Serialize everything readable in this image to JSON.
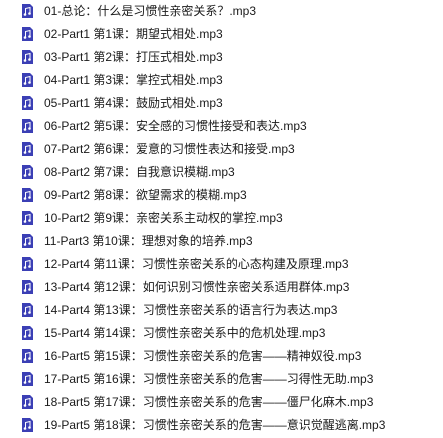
{
  "file_list": {
    "icon": "audio-file-icon",
    "icon_color": "#3b3fb5",
    "items": [
      {
        "name": "01-总论：什么是习惯性亲密关系？.mp3"
      },
      {
        "name": "02-Part1 第1课：期望式相处.mp3"
      },
      {
        "name": "03-Part1 第2课：打压式相处.mp3"
      },
      {
        "name": "04-Part1 第3课：掌控式相处.mp3"
      },
      {
        "name": "05-Part1 第4课：鼓励式相处.mp3"
      },
      {
        "name": "06-Part2 第5课：安全感的习惯性接受和表达.mp3"
      },
      {
        "name": "07-Part2 第6课：爱意的习惯性表达和接受.mp3"
      },
      {
        "name": "08-Part2 第7课：自我意识模糊.mp3"
      },
      {
        "name": "09-Part2 第8课：欲望需求的模糊.mp3"
      },
      {
        "name": "10-Part2 第9课：亲密关系主动权的掌控.mp3"
      },
      {
        "name": "11-Part3 第10课：理想对象的培养.mp3"
      },
      {
        "name": "12-Part4 第11课：习惯性亲密关系的心态构建及原理.mp3"
      },
      {
        "name": "13-Part4 第12课：如何识别习惯性亲密关系适用群体.mp3"
      },
      {
        "name": "14-Part4 第13课：习惯性亲密关系的语言行为表达.mp3"
      },
      {
        "name": "15-Part4 第14课：习惯性亲密关系中的危机处理.mp3"
      },
      {
        "name": "16-Part5 第15课：习惯性亲密关系的危害——精神奴役.mp3"
      },
      {
        "name": "17-Part5 第16课：习惯性亲密关系的危害——习得性无助.mp3"
      },
      {
        "name": "18-Part5 第17课：习惯性亲密关系的危害——僵尸化麻木.mp3"
      },
      {
        "name": "19-Part5 第18课：习惯性亲密关系的危害——意识觉醒逃离.mp3"
      }
    ]
  }
}
